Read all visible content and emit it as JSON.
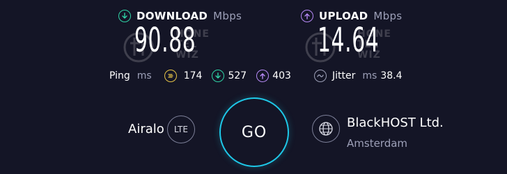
{
  "download": {
    "label": "DOWNLOAD",
    "unit": "Mbps",
    "value": "90.88",
    "icon": "download-arrow-icon",
    "color": "#2fd4a6"
  },
  "upload": {
    "label": "UPLOAD",
    "unit": "Mbps",
    "value": "14.64",
    "icon": "upload-arrow-icon",
    "color": "#b78af7"
  },
  "ping": {
    "label": "Ping",
    "unit": "ms",
    "idle": "174",
    "download": "527",
    "upload": "403",
    "idle_color": "#e8c547"
  },
  "jitter": {
    "label": "Jitter",
    "unit": "ms",
    "value": "38.4"
  },
  "provider": {
    "name": "Airalo",
    "network_badge": "LTE"
  },
  "go_button": {
    "label": "GO"
  },
  "server": {
    "name": "BlackHOST Ltd.",
    "location": "Amsterdam"
  },
  "watermark": {
    "text_line1": "HONE",
    "text_line2": "TEL",
    "text_line3": "WIZ"
  },
  "colors": {
    "background": "#141526",
    "go_ring": "#1ec8e8",
    "muted_text": "#9da0b8"
  }
}
